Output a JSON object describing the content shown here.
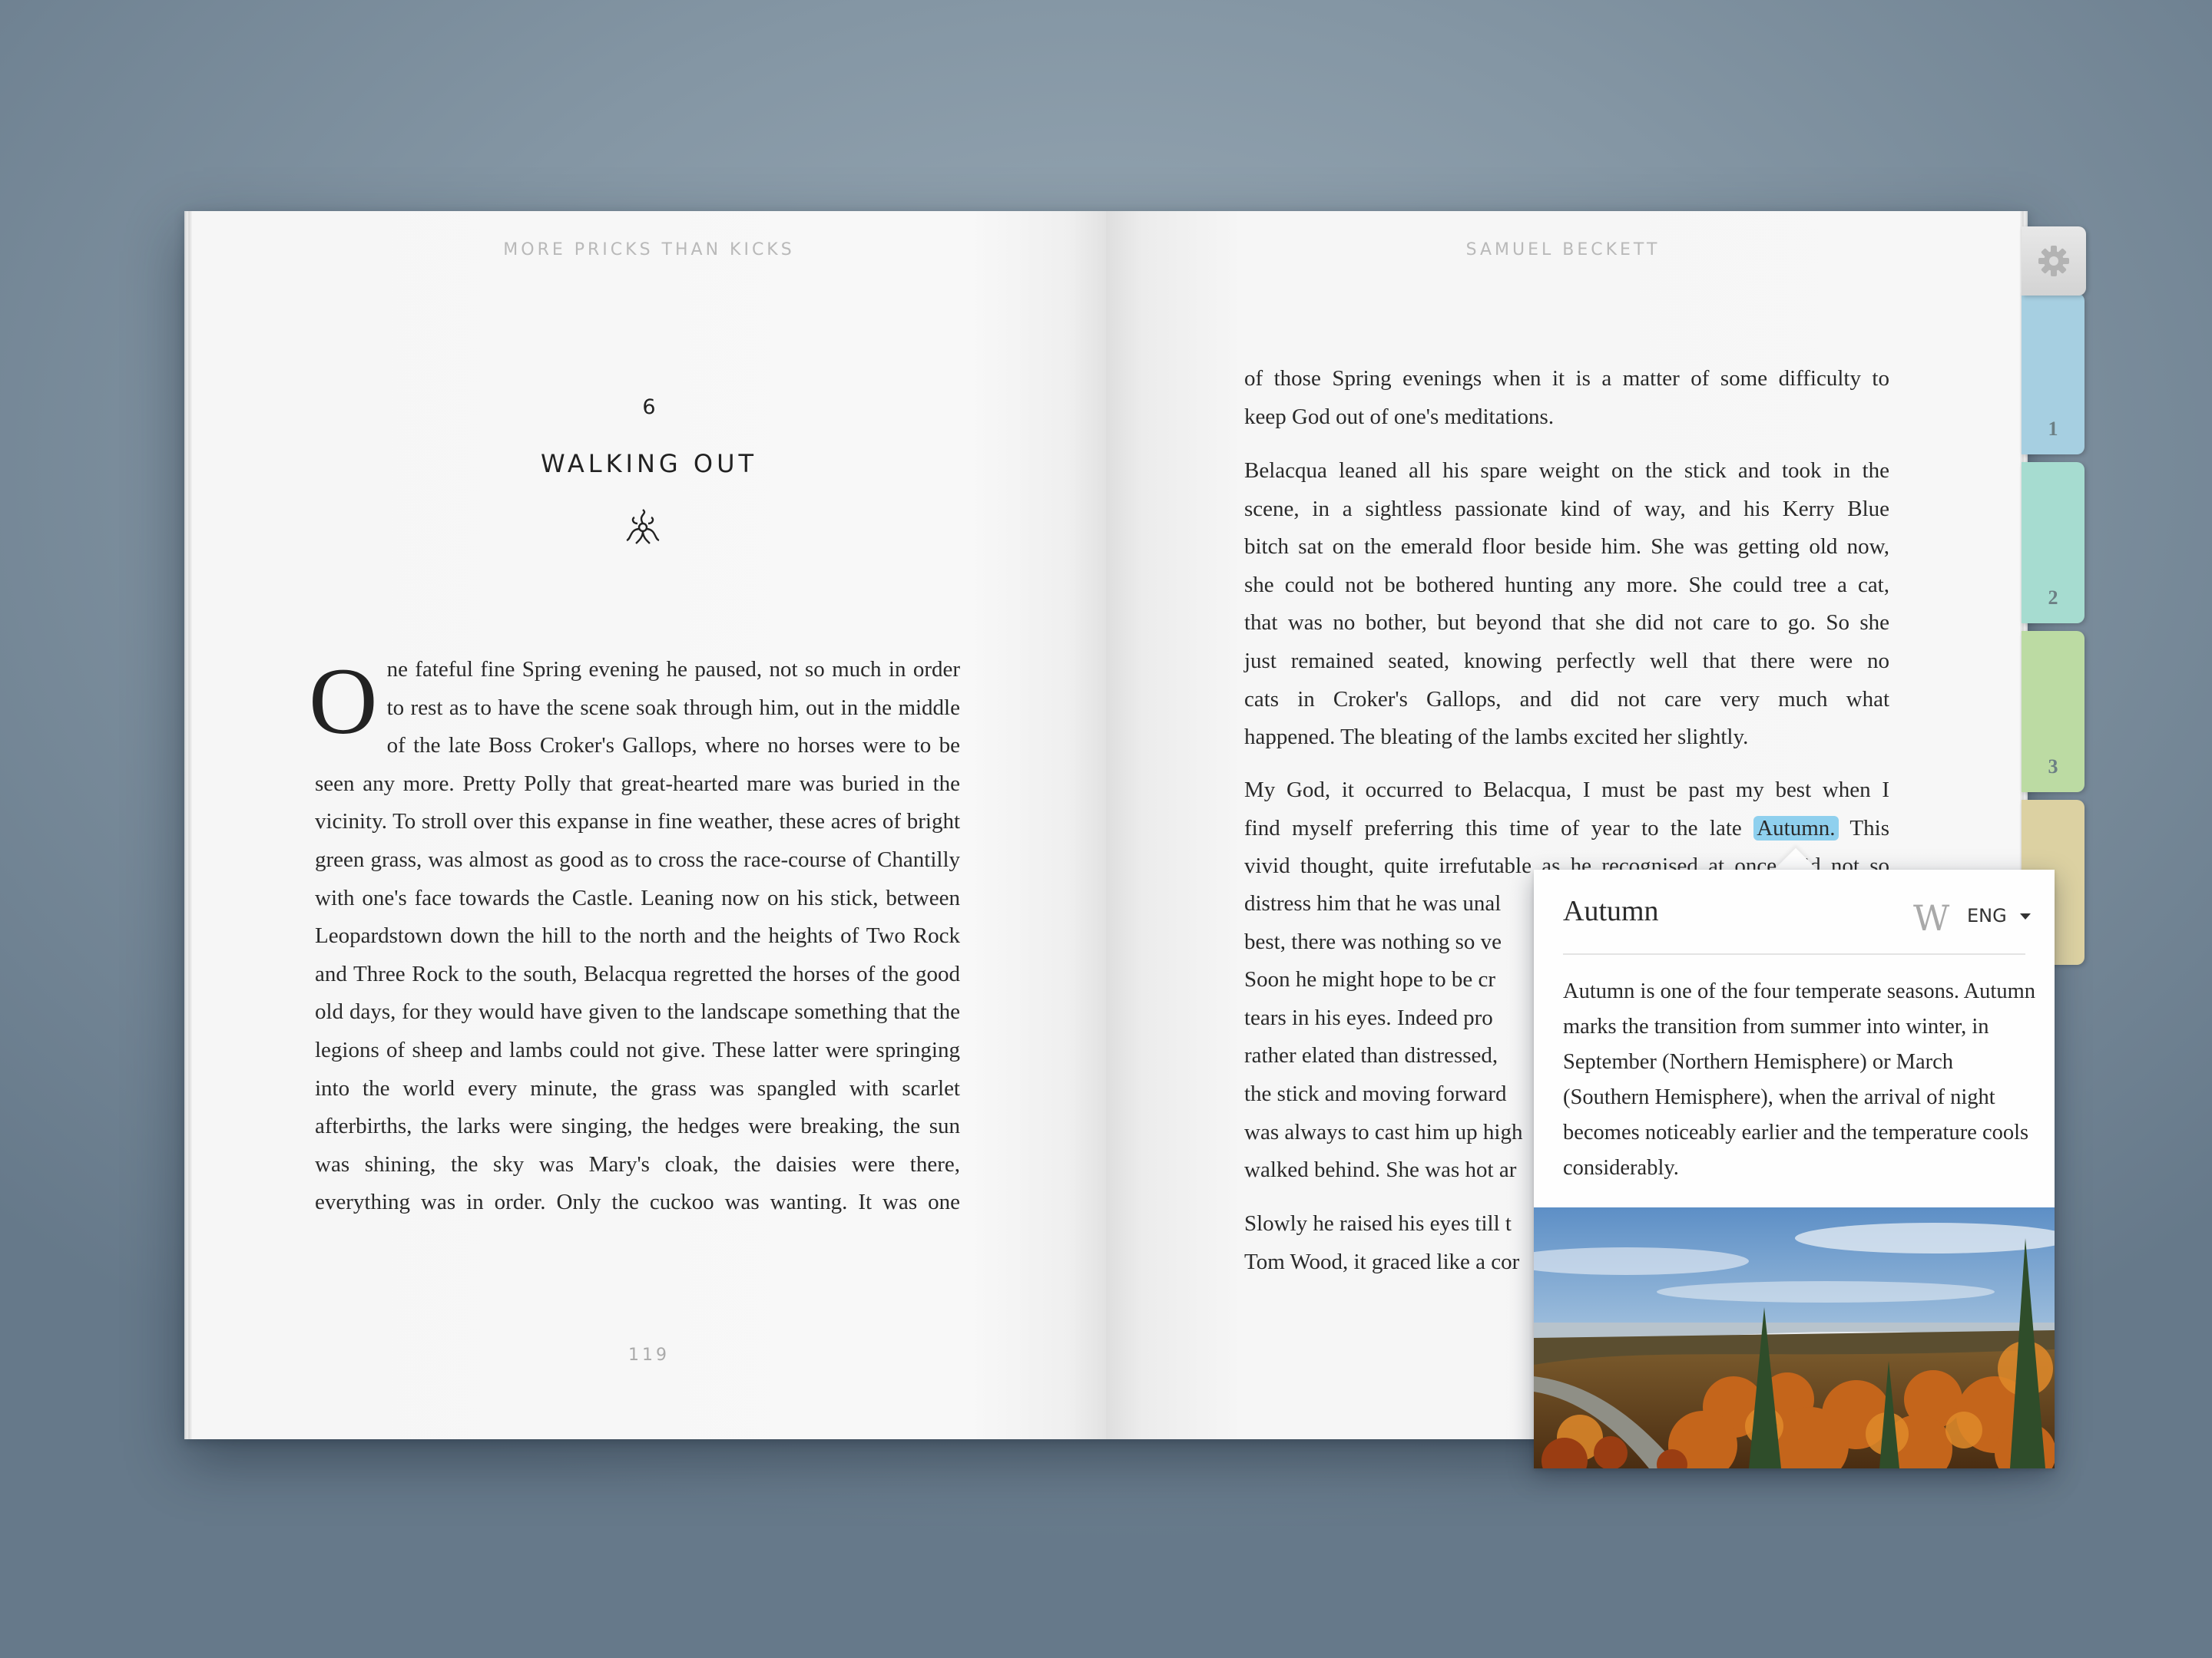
{
  "book": {
    "left_header": "MORE PRICKS THAN KICKS",
    "right_header": "SAMUEL BECKETT",
    "chapter_number": "6",
    "chapter_title": "WALKING OUT",
    "page_number": "119"
  },
  "left_text": {
    "dropcap": "O",
    "body": "ne fateful fine Spring evening he paused, not so much in order to rest as to have the scene soak through him, out in the middle of the late Boss Croker's Gallops, where no horses were to be seen any more. Pretty Polly that great-hearted mare was buried in the vicinity. To stroll over this expanse in fine weather, these acres of bright green grass, was almost as good as to cross the race-course of Chantilly with one's face towards the Castle. Leaning now on his stick, between Leopardstown down the hill to the north and the heights of Two Rock and Three Rock to the south, Belacqua regretted the horses of the good old days, for they would have given to the landscape something that the legions of sheep and lambs could not give. These latter were springing into the world every minute, the grass was spangled with scarlet afterbirths, the larks were singing, the hedges were breaking, the sun was shining, the sky was Mary's cloak, the daisies were there, everything was in order. Only the cuckoo was wanting. It was one"
  },
  "right_text": {
    "p1": [
      "of those Spring evenings when it is a matter of some difficulty to",
      "keep God out of one's meditations."
    ],
    "p2": [
      "Belacqua leaned all his spare weight on the stick and took in the",
      "scene, in a sightless passionate kind of way, and his Kerry Blue",
      "bitch sat on the emerald floor beside him. She was getting old now,",
      "she could not be bothered hunting any more. She could tree a cat,",
      "that was no bother, but beyond that she did not care to go. So she",
      "just remained seated, knowing perfectly well that there were no",
      "cats in Croker's Gallops, and did not care very much what",
      "happened. The bleating of the lambs excited her slightly."
    ],
    "p3_line1": "My God, it occurred to Belacqua, I must be past my best when I",
    "p3_line2_before": "find myself preferring this time of year to the late ",
    "p3_highlight": "Autumn.",
    "p3_line2_after": " This",
    "p3_line3": "vivid thought, quite irrefutable as he recognised at once, did not so",
    "p3_rest": [
      "distress him that he was unal",
      "best, there was nothing so ve",
      "Soon he might hope to be cr",
      "tears in his eyes. Indeed pro",
      "rather elated than distressed,",
      "the stick and moving forward",
      "was always to cast him up high",
      "walked behind. She was hot ar"
    ],
    "p4": [
      "Slowly he raised his eyes till t",
      "Tom Wood, it graced like a cor"
    ]
  },
  "tabs": {
    "items": [
      {
        "label": "1",
        "color": "#a6cfe1"
      },
      {
        "label": "2",
        "color": "#a6dcd0"
      },
      {
        "label": "3",
        "color": "#bcdba3"
      },
      {
        "label": "",
        "color": "#dcd1a2"
      }
    ],
    "settings_icon": "gear-icon"
  },
  "popup": {
    "title": "Autumn",
    "source_icon": "wikipedia-icon",
    "source_glyph": "W",
    "language": "ENG",
    "description": "Autumn is one of the four temperate seasons. Autumn marks the transition from summer into winter, in September (Northern Hemisphere) or March (Southern Hemisphere), when the arrival of night becomes noticeably earlier and the temperature cools considerably."
  },
  "colors": {
    "highlight": "#8fd0ee",
    "background": "#8496a4"
  }
}
